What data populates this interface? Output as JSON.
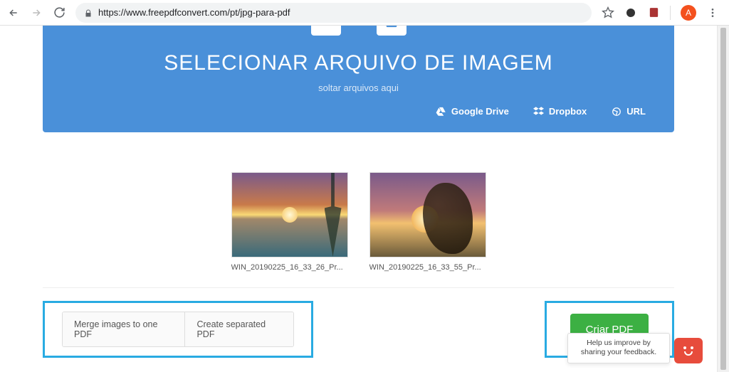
{
  "browser": {
    "url": "https://www.freepdfconvert.com/pt/jpg-para-pdf",
    "avatar_letter": "A"
  },
  "hero": {
    "title": "SELECIONAR ARQUIVO DE IMAGEM",
    "subtitle": "soltar arquivos aqui"
  },
  "sources": {
    "gdrive": "Google Drive",
    "dropbox": "Dropbox",
    "url": "URL"
  },
  "files": [
    {
      "name": "WIN_20190225_16_33_26_Pr..."
    },
    {
      "name": "WIN_20190225_16_33_55_Pr..."
    }
  ],
  "options": {
    "merge": "Merge images to one PDF",
    "separate": "Create separated PDF"
  },
  "actions": {
    "create": "Criar PDF"
  },
  "feedback": {
    "text": "Help us improve by sharing your feedback."
  }
}
